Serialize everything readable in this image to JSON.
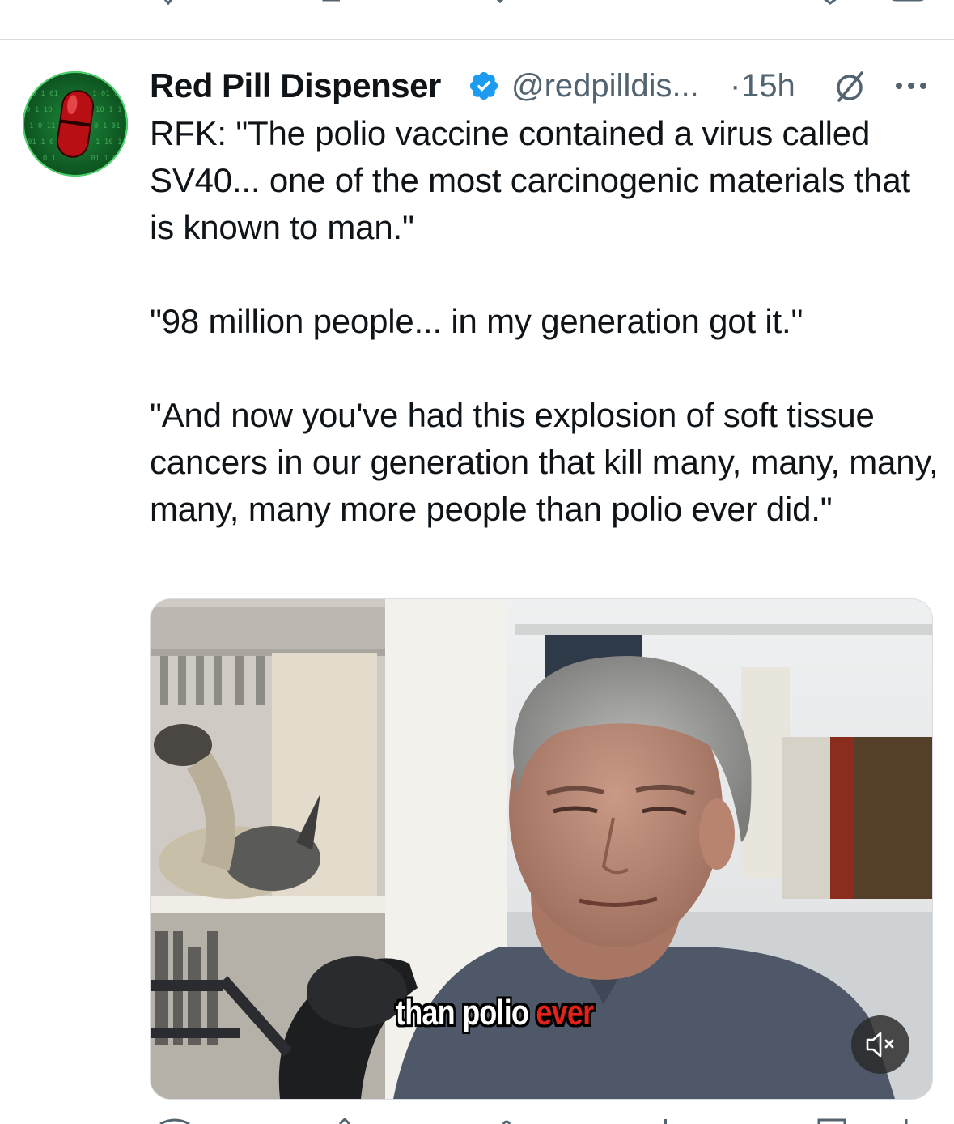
{
  "tweet": {
    "display_name": "Red Pill Dispenser",
    "handle": "@redpilldis...",
    "separator": "·",
    "time": "15h",
    "text": "RFK: \"The polio vaccine contained a virus called SV40... one of the most carcinogenic materials that is known to man.\"\n\n\"98 million people... in my generation got it.\"\n\n\"And now you've had this explosion of soft tissue cancers in our generation that kill many, many, many, many, many more people than polio ever did.\"",
    "verified": true
  },
  "media": {
    "caption_plain": "than polio",
    "caption_highlight": "ever",
    "muted": true
  },
  "icons": {
    "verified": "verified-badge-icon",
    "grok": "grok-icon",
    "more": "more-options-icon",
    "mute": "speaker-muted-icon"
  },
  "colors": {
    "verified_blue": "#1d9bf0",
    "secondary_text": "#536471",
    "caption_highlight": "#e2231a"
  }
}
